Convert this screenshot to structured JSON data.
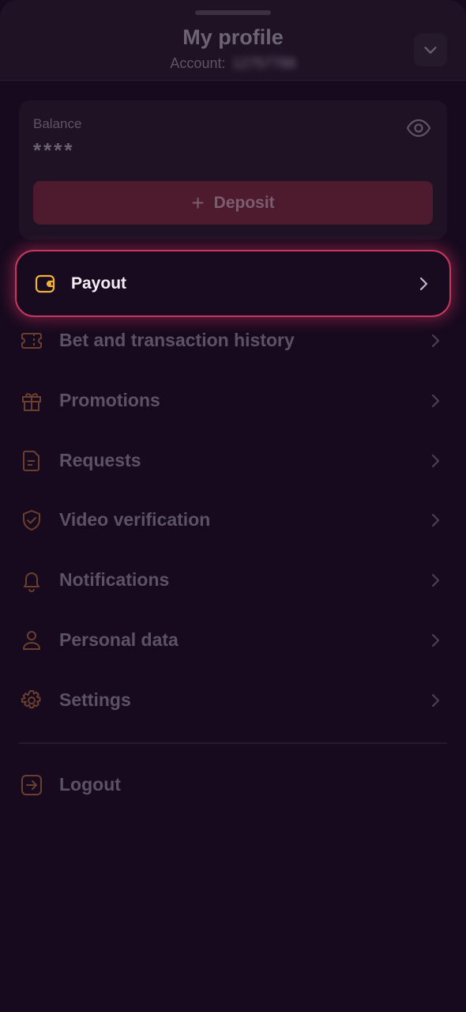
{
  "header": {
    "title": "My profile",
    "account_label": "Account:",
    "account_id": "12757788"
  },
  "balance": {
    "label": "Balance",
    "value": "****",
    "deposit_label": "Deposit"
  },
  "payout": {
    "label": "Payout",
    "icon": "wallet-icon"
  },
  "menu": [
    {
      "label": "Bet and transaction history",
      "icon": "ticket-icon"
    },
    {
      "label": "Promotions",
      "icon": "gift-icon"
    },
    {
      "label": "Requests",
      "icon": "document-icon"
    },
    {
      "label": "Video verification",
      "icon": "shield-check-icon"
    },
    {
      "label": "Notifications",
      "icon": "bell-icon"
    },
    {
      "label": "Personal data",
      "icon": "user-icon"
    },
    {
      "label": "Settings",
      "icon": "gear-icon"
    }
  ],
  "logout": {
    "label": "Logout",
    "icon": "logout-icon"
  },
  "colors": {
    "background": "#170a1e",
    "accent_icon": "#f0b238",
    "highlight_border": "#c8375e",
    "deposit_bg": "#4e1a2e"
  }
}
